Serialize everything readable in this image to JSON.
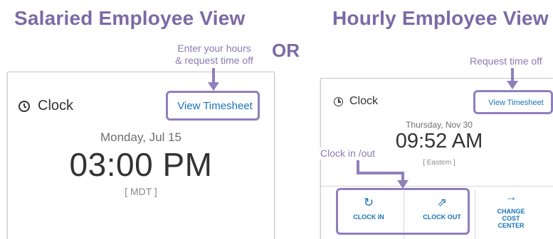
{
  "headings": {
    "salaried": "Salaried Employee View",
    "or": "OR",
    "hourly": "Hourly Employee View"
  },
  "annotations": {
    "salaried_line1": "Enter your hours",
    "salaried_line2": "& request time off",
    "hourly_request": "Request time off",
    "clock_inout": "Clock in /out"
  },
  "salaried_card": {
    "title": "Clock",
    "timesheet_button": "View Timesheet",
    "date": "Monday, Jul 15",
    "time": "03:00 PM",
    "timezone": "[ MDT ]"
  },
  "hourly_card": {
    "title": "Clock",
    "timesheet_button": "View Timesheet",
    "date": "Thursday, Nov 30",
    "time": "09:52 AM",
    "timezone": "[ Eastern ]",
    "actions": [
      {
        "label": "CLOCK IN",
        "icon": "clock-in-icon"
      },
      {
        "label": "CLOCK OUT",
        "icon": "clock-out-icon"
      },
      {
        "label": "CHANGE COST CENTER",
        "icon": "arrow-right-icon"
      }
    ]
  },
  "colors": {
    "accent_purple": "#8f7fbd",
    "heading_purple": "#7b6aa6",
    "link_blue": "#1a73b8"
  }
}
